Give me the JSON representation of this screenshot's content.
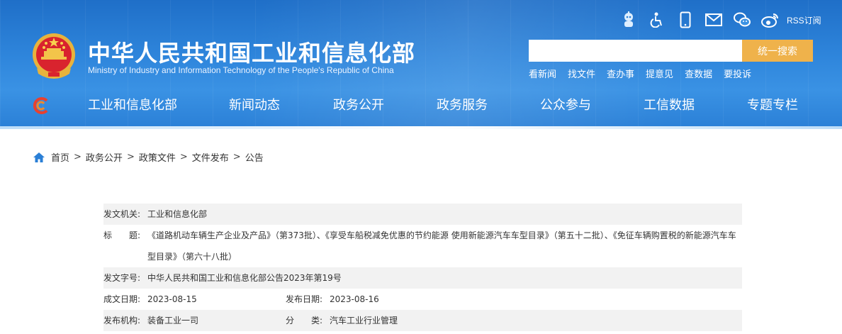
{
  "header": {
    "title": "中华人民共和国工业和信息化部",
    "subtitle": "Ministry of Industry and Information Technology of the People's Republic of China",
    "rss_label": "RSS订阅",
    "top_icons": [
      "robot-icon",
      "accessibility-icon",
      "mobile-icon",
      "mail-icon",
      "wechat-icon",
      "weibo-icon"
    ],
    "search": {
      "placeholder": "",
      "button_label": "统一搜索"
    },
    "quick_links": [
      "看新闻",
      "找文件",
      "查办事",
      "提意见",
      "查数据",
      "要投诉"
    ],
    "colors": {
      "header_bg": "#2a7fd6",
      "search_button": "#efb24b"
    }
  },
  "nav": {
    "items": [
      "工业和信息化部",
      "新闻动态",
      "政务公开",
      "政务服务",
      "公众参与",
      "工信数据",
      "专题专栏"
    ]
  },
  "breadcrumb": {
    "items": [
      "首页",
      "政务公开",
      "政策文件",
      "文件发布",
      "公告"
    ],
    "separator": ">"
  },
  "document": {
    "issuer_label": "发文机关:",
    "issuer": "工业和信息化部",
    "title_label": "标　　题:",
    "title": "《道路机动车辆生产企业及产品》（第373批）、《享受车船税减免优惠的节约能源 使用新能源汽车车型目录》（第五十二批）、《免征车辆购置税的新能源汽车车型目录》（第六十八批）",
    "doc_no_label": "发文字号:",
    "doc_no": "中华人民共和国工业和信息化部公告2023年第19号",
    "created_label": "成文日期:",
    "created": "2023-08-15",
    "published_label": "发布日期:",
    "published": "2023-08-16",
    "org_label": "发布机构:",
    "org": "装备工业一司",
    "category_label": "分　　类:",
    "category": "汽车工业行业管理"
  }
}
